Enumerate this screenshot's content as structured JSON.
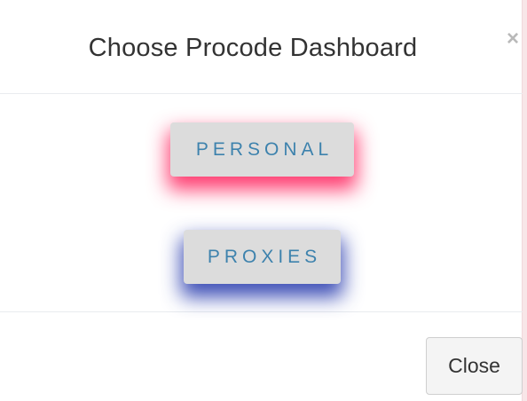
{
  "modal": {
    "title": "Choose Procode Dashboard",
    "close_icon": "×",
    "buttons": {
      "personal": "PERSONAL",
      "proxies": "PROXIES"
    },
    "footer": {
      "close_label": "Close"
    }
  },
  "icons": {
    "close": "close-icon"
  },
  "colors": {
    "page_background": "#f8e6e8",
    "button_background": "#dcdcdc",
    "button_text": "#3d82ad",
    "personal_glow": "#ff1e5a",
    "proxies_glow": "#1e32aa"
  }
}
